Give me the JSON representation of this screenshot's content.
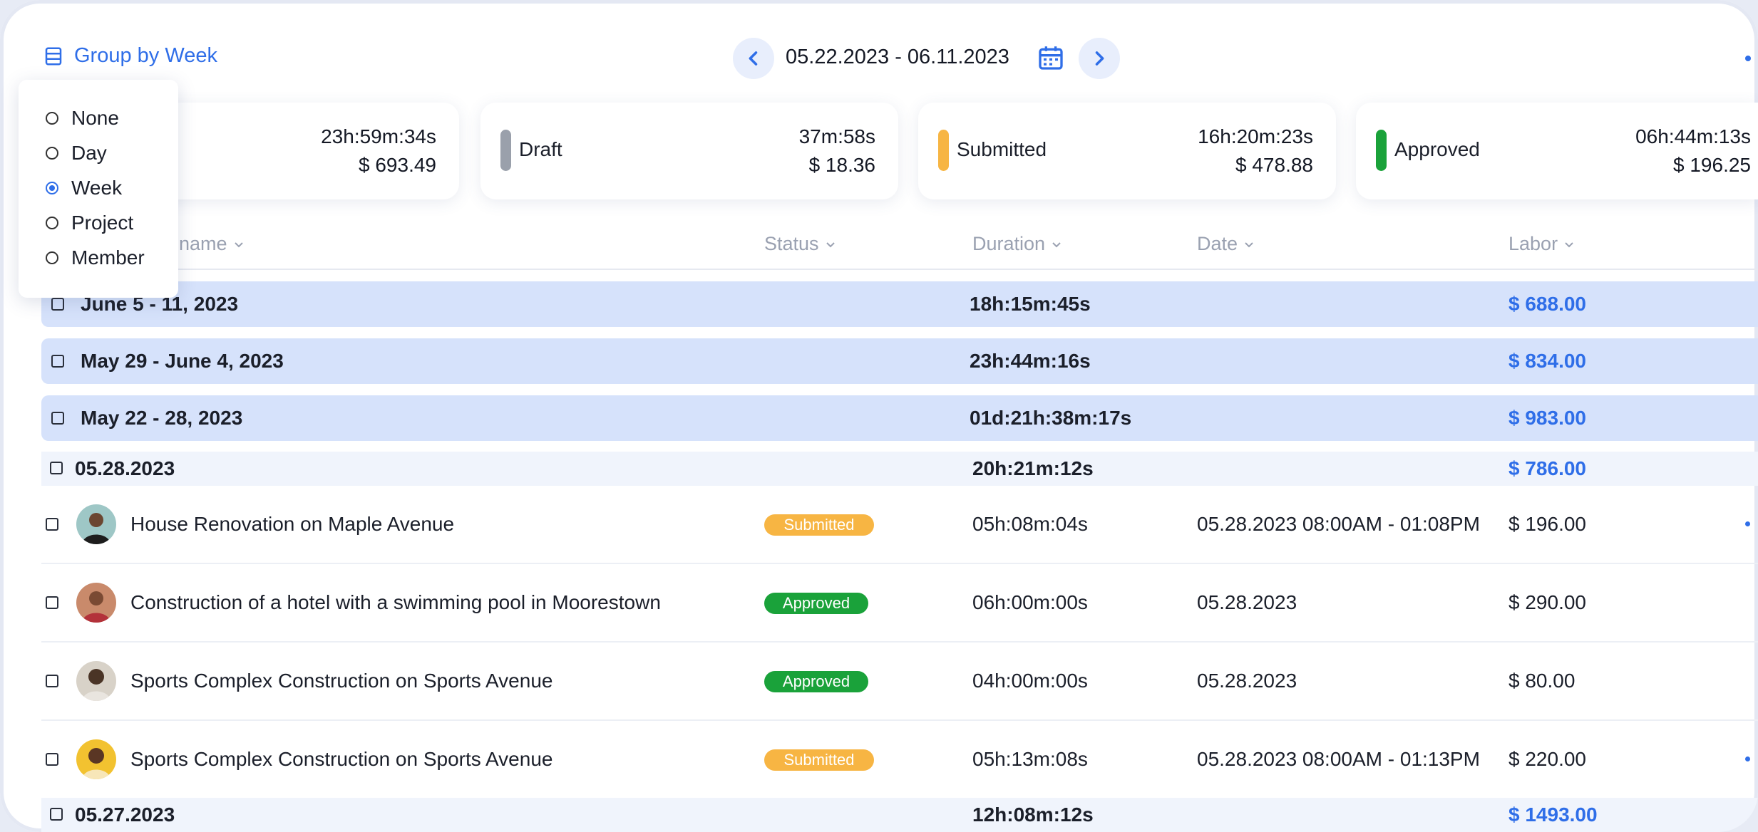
{
  "toolbar": {
    "group_by_label": "Group by Week",
    "date_range": "05.22.2023 - 06.11.2023"
  },
  "group_options": [
    {
      "label": "None",
      "selected": false
    },
    {
      "label": "Day",
      "selected": false
    },
    {
      "label": "Week",
      "selected": true
    },
    {
      "label": "Project",
      "selected": false
    },
    {
      "label": "Member",
      "selected": false
    }
  ],
  "summary_cards": [
    {
      "label": "",
      "duration": "23h:59m:34s",
      "amount": "$ 693.49",
      "color": ""
    },
    {
      "label": "Draft",
      "duration": "37m:58s",
      "amount": "$ 18.36",
      "color": "#9aa0ab"
    },
    {
      "label": "Submitted",
      "duration": "16h:20m:23s",
      "amount": "$ 478.88",
      "color": "#f7b543"
    },
    {
      "label": "Approved",
      "duration": "06h:44m:13s",
      "amount": "$ 196.25",
      "color": "#1aa23a"
    }
  ],
  "table": {
    "columns": {
      "name": "y name",
      "status": "Status",
      "duration": "Duration",
      "date": "Date",
      "labor": "Labor"
    },
    "weeks": [
      {
        "label": "June 5 - 11, 2023",
        "duration": "18h:15m:45s",
        "labor": "$ 688.00"
      },
      {
        "label": "May 29 - June 4, 2023",
        "duration": "23h:44m:16s",
        "labor": "$ 834.00"
      },
      {
        "label": "May 22 - 28, 2023",
        "duration": "01d:21h:38m:17s",
        "labor": "$ 983.00"
      }
    ],
    "days": [
      {
        "label": "05.28.2023",
        "duration": "20h:21m:12s",
        "labor": "$ 786.00"
      },
      {
        "label": "05.27.2023",
        "duration": "12h:08m:12s",
        "labor": "$ 1493.00"
      }
    ],
    "entries": [
      {
        "name": "House Renovation on Maple Avenue",
        "status": "Submitted",
        "duration": "05h:08m:04s",
        "date": "05.28.2023 08:00AM - 01:08PM",
        "labor": "$ 196.00"
      },
      {
        "name": "Construction of a hotel with a swimming pool in Moorestown",
        "status": "Approved",
        "duration": "06h:00m:00s",
        "date": "05.28.2023",
        "labor": "$ 290.00"
      },
      {
        "name": "Sports Complex Construction on Sports Avenue",
        "status": "Approved",
        "duration": "04h:00m:00s",
        "date": "05.28.2023",
        "labor": "$ 80.00"
      },
      {
        "name": "Sports Complex Construction on Sports Avenue",
        "status": "Submitted",
        "duration": "05h:13m:08s",
        "date": "05.28.2023 08:00AM - 01:13PM",
        "labor": "$ 220.00"
      }
    ]
  },
  "colors": {
    "accent": "#2f6ee8",
    "week_row_bg": "#d6e2fb",
    "day_row_bg": "#f0f4fc",
    "submitted": "#f7b543",
    "approved": "#1aa23a"
  }
}
